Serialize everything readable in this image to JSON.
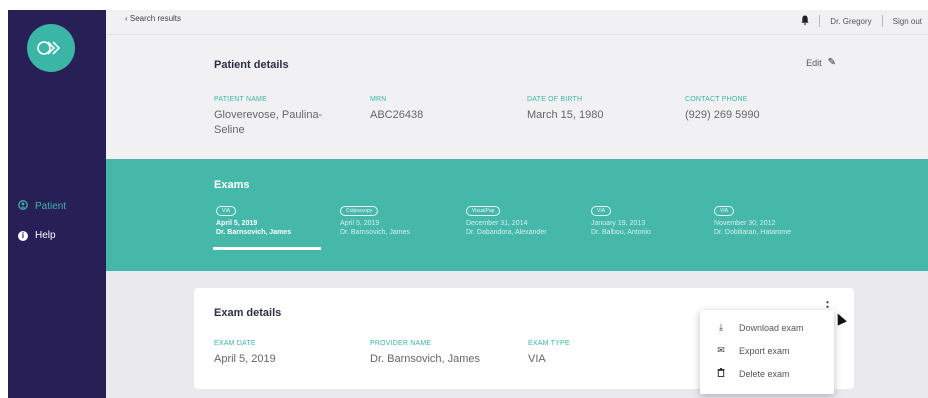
{
  "topbar": {
    "back_label": "‹ Search results",
    "bell_icon": "bell-icon",
    "user_name": "Dr. Gregory",
    "sign_out_label": "Sign out"
  },
  "sidebar": {
    "logo_icon": "chevrons-logo",
    "items": [
      {
        "label": "Patient",
        "icon": "person-icon",
        "active": true
      },
      {
        "label": "Help",
        "icon": "info-icon",
        "active": false
      }
    ]
  },
  "patient": {
    "title": "Patient details",
    "edit_label": "Edit",
    "fields": [
      {
        "label": "PATIENT NAME",
        "value": "Gloverevose, Paulina-Seline"
      },
      {
        "label": "MRN",
        "value": "ABC26438"
      },
      {
        "label": "DATE OF BIRTH",
        "value": "March 15, 1980"
      },
      {
        "label": "CONTACT PHONE",
        "value": "(929) 269 5990"
      }
    ]
  },
  "exams": {
    "title": "Exams",
    "tabs": [
      {
        "badge": "VIA",
        "date": "April 5, 2019",
        "provider": "Dr. Barnsovich, James",
        "active": true
      },
      {
        "badge": "Colposcopy",
        "date": "April 5, 2019",
        "provider": "Dr. Barnsovich, James",
        "active": false
      },
      {
        "badge": "VisualPap",
        "date": "December 31, 2014",
        "provider": "Dr. Dabandora, Alexander",
        "active": false
      },
      {
        "badge": "VIA",
        "date": "January 19, 2013",
        "provider": "Dr. Balbou, Antonio",
        "active": false
      },
      {
        "badge": "VIA",
        "date": "November 30, 2012",
        "provider": "Dr. Dobiliaran, Hatarome",
        "active": false
      }
    ]
  },
  "exam_details": {
    "title": "Exam details",
    "fields": [
      {
        "label": "EXAM DATE",
        "value": "April 5, 2019"
      },
      {
        "label": "PROVIDER NAME",
        "value": "Dr. Barnsovich, James"
      },
      {
        "label": "EXAM TYPE",
        "value": "VIA"
      }
    ]
  },
  "menu": {
    "items": [
      {
        "label": "Download exam",
        "icon": "download-icon"
      },
      {
        "label": "Export exam",
        "icon": "envelope-icon"
      },
      {
        "label": "Delete exam",
        "icon": "trash-icon"
      }
    ]
  },
  "colors": {
    "sidebar_bg": "#281f57",
    "accent_teal": "#45b8aa",
    "panel_bg": "#f1f1f3"
  }
}
